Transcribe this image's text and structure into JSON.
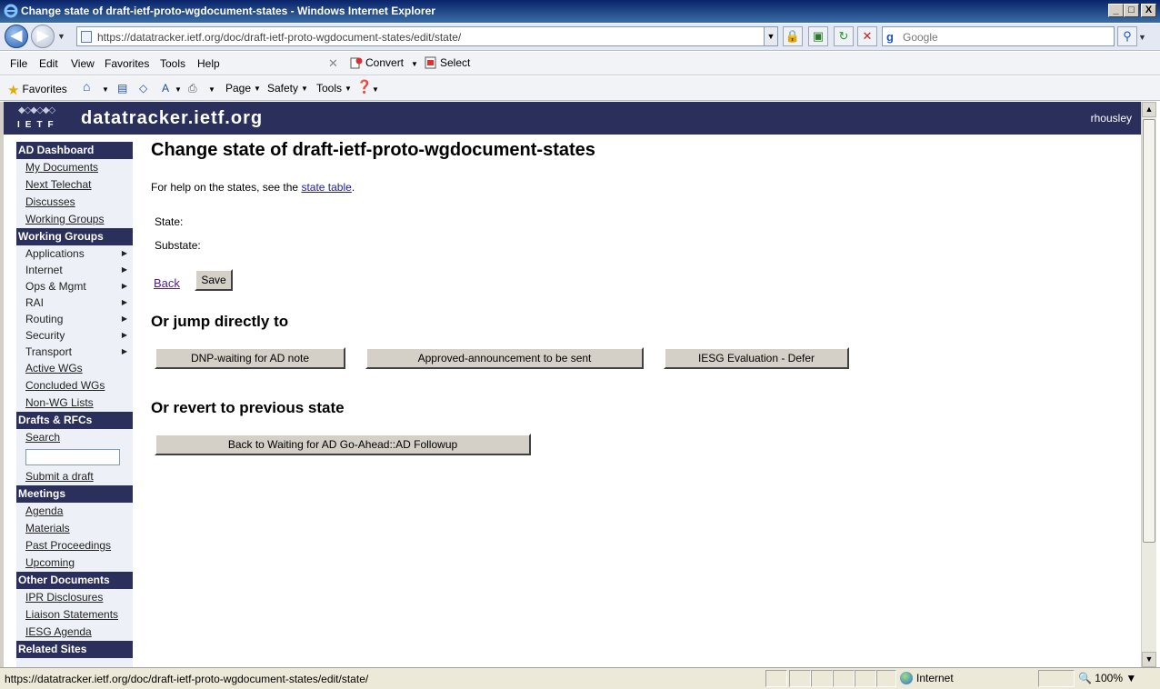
{
  "window": {
    "title": "Change state of draft-ietf-proto-wgdocument-states - Windows Internet Explorer",
    "minimize": "_",
    "maximize": "□",
    "close": "X"
  },
  "address": {
    "url": "https://datatracker.ietf.org/doc/draft-ietf-proto-wgdocument-states/edit/state/",
    "search_placeholder": "Google"
  },
  "menu": {
    "items": [
      "File",
      "Edit",
      "View",
      "Favorites",
      "Tools",
      "Help"
    ],
    "convert": "Convert",
    "select": "Select"
  },
  "favbar": {
    "favorites": "Favorites",
    "page": "Page",
    "safety": "Safety",
    "tools": "Tools"
  },
  "site": {
    "logo_text": "IETF",
    "name": "datatracker.ietf.org",
    "user": "rhousley"
  },
  "sidebar": {
    "ad_dashboard": {
      "title": "AD Dashboard",
      "links": [
        "My Documents",
        "Next Telechat",
        "Discusses",
        "Working Groups"
      ]
    },
    "working_groups": {
      "title": "Working Groups",
      "areas": [
        "Applications",
        "Internet",
        "Ops & Mgmt",
        "RAI",
        "Routing",
        "Security",
        "Transport"
      ],
      "links": [
        "Active WGs",
        "Concluded WGs",
        "Non-WG Lists"
      ]
    },
    "drafts": {
      "title": "Drafts & RFCs",
      "search": "Search",
      "submit": "Submit a draft"
    },
    "meetings": {
      "title": "Meetings",
      "links": [
        "Agenda",
        "Materials",
        "Past Proceedings",
        "Upcoming"
      ]
    },
    "other_documents": {
      "title": "Other Documents",
      "links": [
        "IPR Disclosures",
        "Liaison Statements",
        "IESG Agenda"
      ]
    },
    "related_sites": {
      "title": "Related Sites"
    }
  },
  "main": {
    "title": "Change state of draft-ietf-proto-wgdocument-states",
    "help_prefix": "For help on the states, see the ",
    "help_link": "state table",
    "help_suffix": ".",
    "state_label": "State:",
    "substate_label": "Substate:",
    "back": "Back",
    "save": "Save",
    "jump_heading": "Or jump directly to",
    "jump_buttons": [
      "DNP-waiting for AD note",
      "Approved-announcement to be sent",
      "IESG Evaluation - Defer"
    ],
    "revert_heading": "Or revert to previous state",
    "revert_button": "Back to Waiting for AD Go-Ahead::AD Followup"
  },
  "status": {
    "url": "https://datatracker.ietf.org/doc/draft-ietf-proto-wgdocument-states/edit/state/",
    "zone": "Internet",
    "zoom": "100%"
  }
}
